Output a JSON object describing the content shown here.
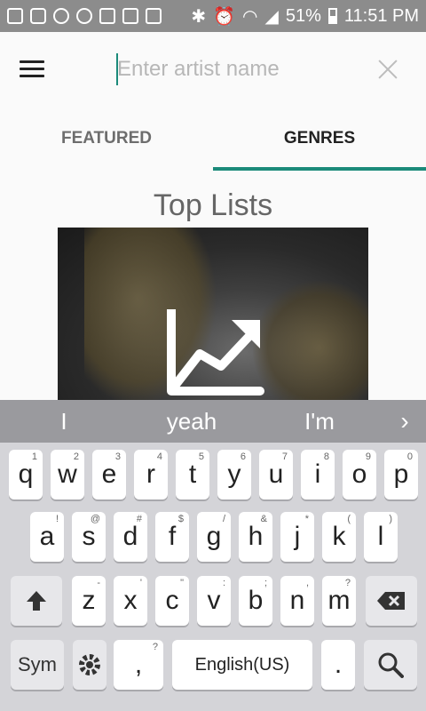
{
  "status_bar": {
    "battery": "51%",
    "time": "11:51 PM"
  },
  "app_bar": {
    "search_placeholder": "Enter artist name"
  },
  "tabs": [
    {
      "label": "FEATURED"
    },
    {
      "label": "GENRES"
    }
  ],
  "section": {
    "title": "Top Lists"
  },
  "keyboard": {
    "suggestions": [
      "I",
      "yeah",
      "I'm"
    ],
    "row1": [
      {
        "k": "q",
        "h": "1"
      },
      {
        "k": "w",
        "h": "2"
      },
      {
        "k": "e",
        "h": "3"
      },
      {
        "k": "r",
        "h": "4"
      },
      {
        "k": "t",
        "h": "5"
      },
      {
        "k": "y",
        "h": "6"
      },
      {
        "k": "u",
        "h": "7"
      },
      {
        "k": "i",
        "h": "8"
      },
      {
        "k": "o",
        "h": "9"
      },
      {
        "k": "p",
        "h": "0"
      }
    ],
    "row2": [
      {
        "k": "a",
        "h": "!"
      },
      {
        "k": "s",
        "h": "@"
      },
      {
        "k": "d",
        "h": "#"
      },
      {
        "k": "f",
        "h": "$"
      },
      {
        "k": "g",
        "h": "/"
      },
      {
        "k": "h",
        "h": "&"
      },
      {
        "k": "j",
        "h": "*"
      },
      {
        "k": "k",
        "h": "("
      },
      {
        "k": "l",
        "h": ")"
      }
    ],
    "row3": [
      {
        "k": "z",
        "h": "-"
      },
      {
        "k": "x",
        "h": "'"
      },
      {
        "k": "c",
        "h": "\""
      },
      {
        "k": "v",
        "h": ":"
      },
      {
        "k": "b",
        "h": ";"
      },
      {
        "k": "n",
        "h": ","
      },
      {
        "k": "m",
        "h": "?"
      }
    ],
    "sym_label": "Sym",
    "comma_label": ",",
    "comma_hint": "?",
    "space_label": "English(US)",
    "period_label": "."
  },
  "colors": {
    "accent": "#1b8a7a",
    "status_bar": "#8c8c8c",
    "suggestion_bar": "#9a9a9e"
  }
}
